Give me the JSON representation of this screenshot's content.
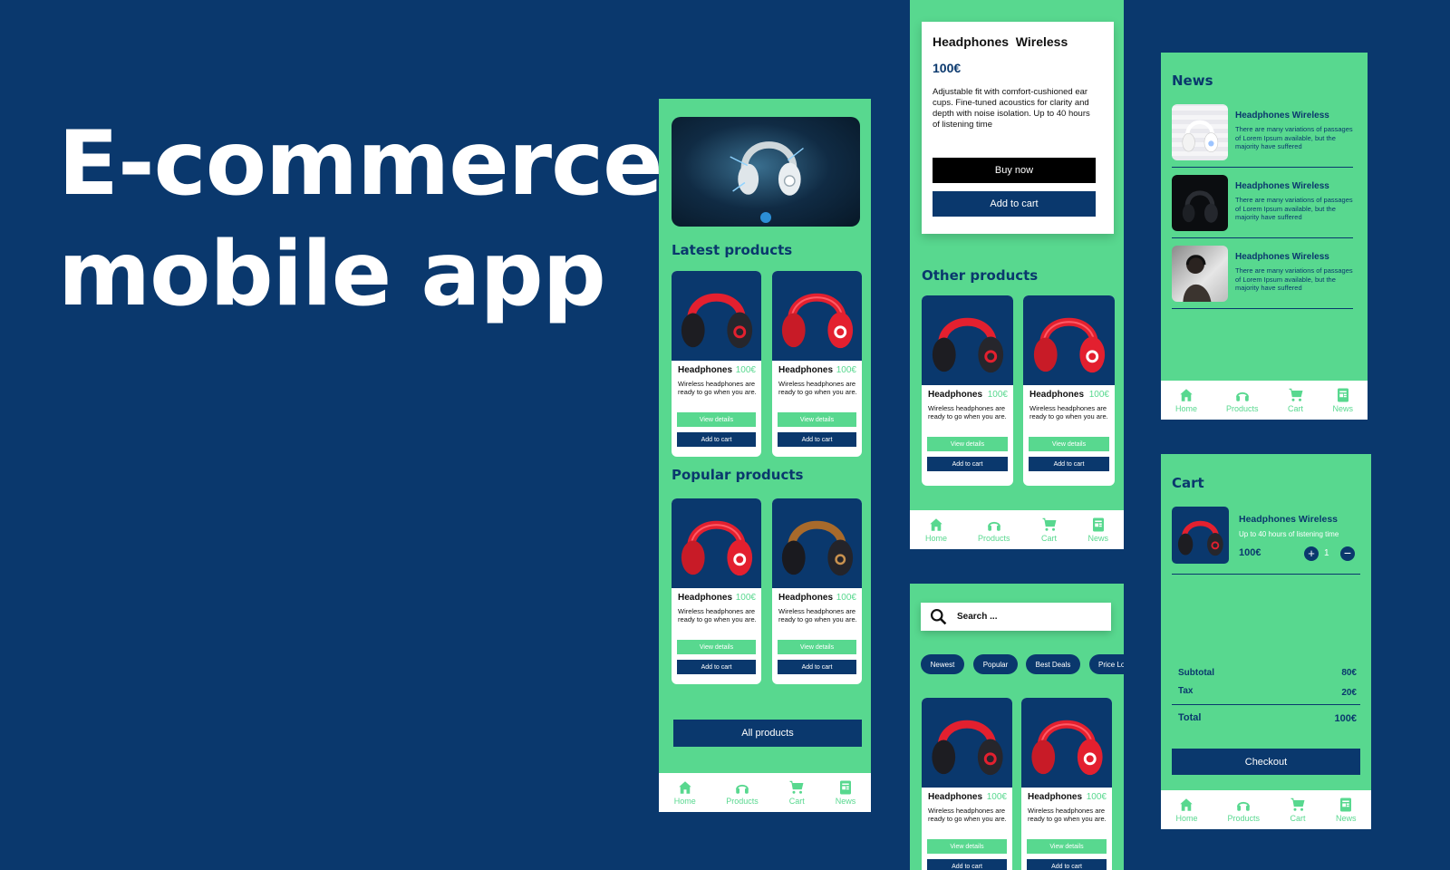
{
  "hero": {
    "line1": "E-commerce",
    "line2": "mobile app"
  },
  "colors": {
    "background": "#0a386d",
    "accent": "#58d88f",
    "product_red": "#e3202f",
    "white": "#ffffff"
  },
  "nav": {
    "home": "Home",
    "products": "Products",
    "cart": "Cart",
    "news": "News"
  },
  "card": {
    "name": "Headphones",
    "price": "100€",
    "desc": "Wireless headphones are ready to go when you are.",
    "view": "View details",
    "add": "Add to cart"
  },
  "home": {
    "latest_title": "Latest products",
    "popular_title": "Popular products",
    "all_products": "All products"
  },
  "detail": {
    "title": "Headphones  Wireless",
    "price": "100€",
    "desc": "Adjustable fit with comfort-cushioned ear cups. Fine-tuned acoustics for clarity and depth with noise isolation. Up to 40 hours of listening time",
    "buy_now": "Buy now",
    "add_to_cart": "Add to cart",
    "other_title": "Other products"
  },
  "search": {
    "placeholder": "Search ...",
    "chips": [
      "Newest",
      "Popular",
      "Best Deals",
      "Price Lo"
    ]
  },
  "news": {
    "title": "News",
    "items": [
      {
        "title": "Headphones Wireless",
        "desc": "There are many variations of passages of Lorem Ipsum available, but the majority have suffered"
      },
      {
        "title": "Headphones Wireless",
        "desc": "There are many variations of passages of Lorem Ipsum available, but the majority have suffered"
      },
      {
        "title": "Headphones Wireless",
        "desc": "There are many variations of passages of Lorem Ipsum available, but the majority have suffered"
      }
    ]
  },
  "cart": {
    "title": "Cart",
    "item_name": "Headphones Wireless",
    "item_desc": "Up to 40 hours of listening time",
    "item_price": "100€",
    "qty": "1",
    "subtotal_label": "Subtotal",
    "subtotal_value": "80€",
    "tax_label": "Tax",
    "tax_value": "20€",
    "total_label": "Total",
    "total_value": "100€",
    "checkout": "Checkout"
  },
  "icons": [
    "home-icon",
    "headphones-icon",
    "cart-icon",
    "news-icon",
    "search-icon",
    "plus-icon",
    "minus-icon"
  ]
}
